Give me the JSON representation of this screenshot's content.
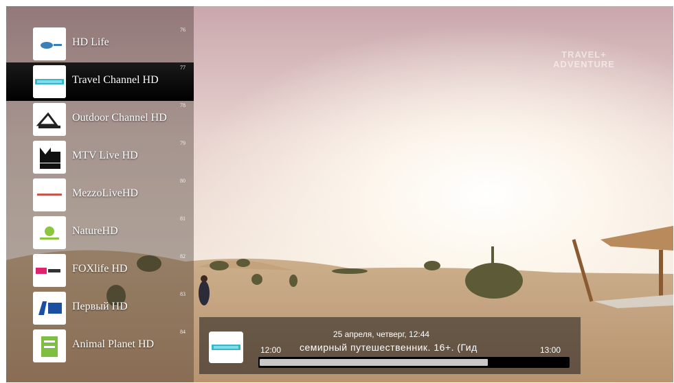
{
  "channels": [
    {
      "number": "76",
      "name": "HD Life",
      "logo": "hd-life-logo"
    },
    {
      "number": "77",
      "name": "Travel Channel HD",
      "logo": "travel-channel-logo",
      "selected": true
    },
    {
      "number": "78",
      "name": "Outdoor Channel HD",
      "logo": "outdoor-channel-logo"
    },
    {
      "number": "79",
      "name": "MTV Live HD",
      "logo": "mtv-live-logo"
    },
    {
      "number": "80",
      "name": "MezzoLiveHD",
      "logo": "mezzo-live-logo"
    },
    {
      "number": "81",
      "name": "NatureHD",
      "logo": "nature-hd-logo"
    },
    {
      "number": "82",
      "name": "FOXlife HD",
      "logo": "foxlife-logo"
    },
    {
      "number": "83",
      "name": "Первый HD",
      "logo": "perviy-hd-logo"
    },
    {
      "number": "84",
      "name": "Animal Planet HD",
      "logo": "animal-planet-logo"
    }
  ],
  "now_playing": {
    "date": "25 апреля, четверг, 12:44",
    "start": "12:00",
    "title": "семирный путешественник. 16+. (Гид",
    "end": "13:00",
    "progress": 0.74,
    "channel_logo": "travel-channel-logo"
  },
  "colors": {
    "selected_row": "#000000",
    "progress_track": "#000000",
    "progress_fill": "#c8c8c8",
    "text": "#ffffff"
  }
}
